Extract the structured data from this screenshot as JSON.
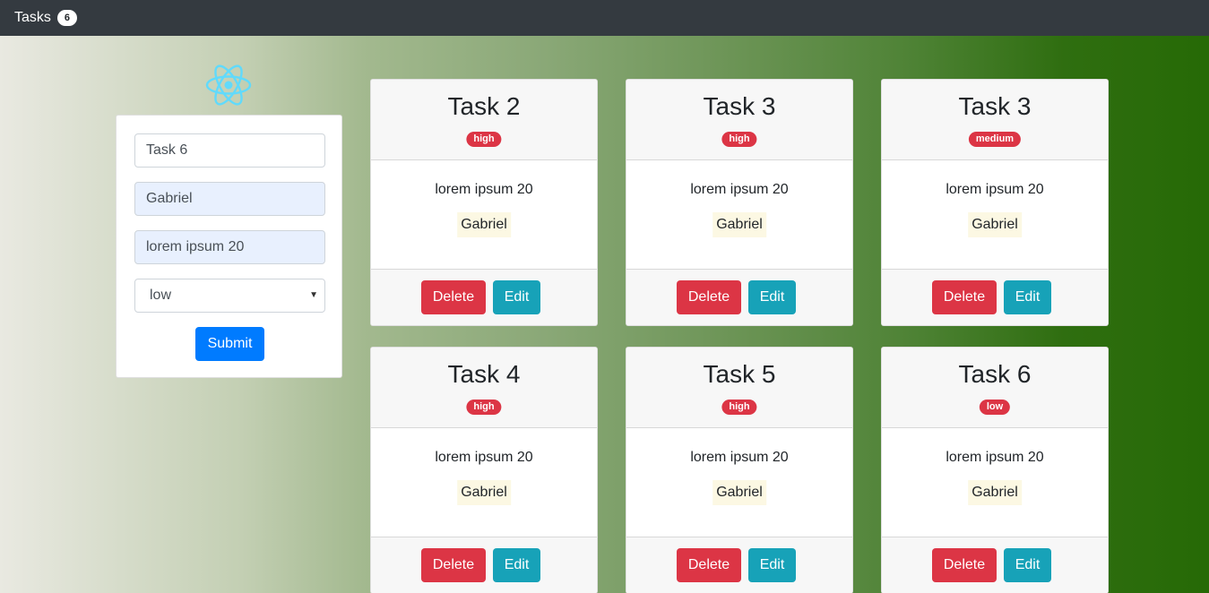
{
  "navbar": {
    "brand": "Tasks",
    "count": "6"
  },
  "logo": {
    "icon": "react-atom-icon",
    "color": "#61dafb"
  },
  "form": {
    "title_value": "Task 6",
    "responsible_value": "Gabriel",
    "description_value": "lorem ipsum 20",
    "priority_value": "low",
    "submit_label": "Submit"
  },
  "tasks": [
    {
      "title": "Task 2",
      "priority": "high",
      "description": "lorem ipsum 20",
      "responsible": "Gabriel",
      "delete_label": "Delete",
      "edit_label": "Edit"
    },
    {
      "title": "Task 3",
      "priority": "high",
      "description": "lorem ipsum 20",
      "responsible": "Gabriel",
      "delete_label": "Delete",
      "edit_label": "Edit"
    },
    {
      "title": "Task 3",
      "priority": "medium",
      "description": "lorem ipsum 20",
      "responsible": "Gabriel",
      "delete_label": "Delete",
      "edit_label": "Edit"
    },
    {
      "title": "Task 4",
      "priority": "high",
      "description": "lorem ipsum 20",
      "responsible": "Gabriel",
      "delete_label": "Delete",
      "edit_label": "Edit"
    },
    {
      "title": "Task 5",
      "priority": "high",
      "description": "lorem ipsum 20",
      "responsible": "Gabriel",
      "delete_label": "Delete",
      "edit_label": "Edit"
    },
    {
      "title": "Task 6",
      "priority": "low",
      "description": "lorem ipsum 20",
      "responsible": "Gabriel",
      "delete_label": "Delete",
      "edit_label": "Edit"
    }
  ],
  "colors": {
    "navbar": "#343a40",
    "danger": "#dc3545",
    "info": "#17a2b8",
    "primary": "#007bff"
  }
}
